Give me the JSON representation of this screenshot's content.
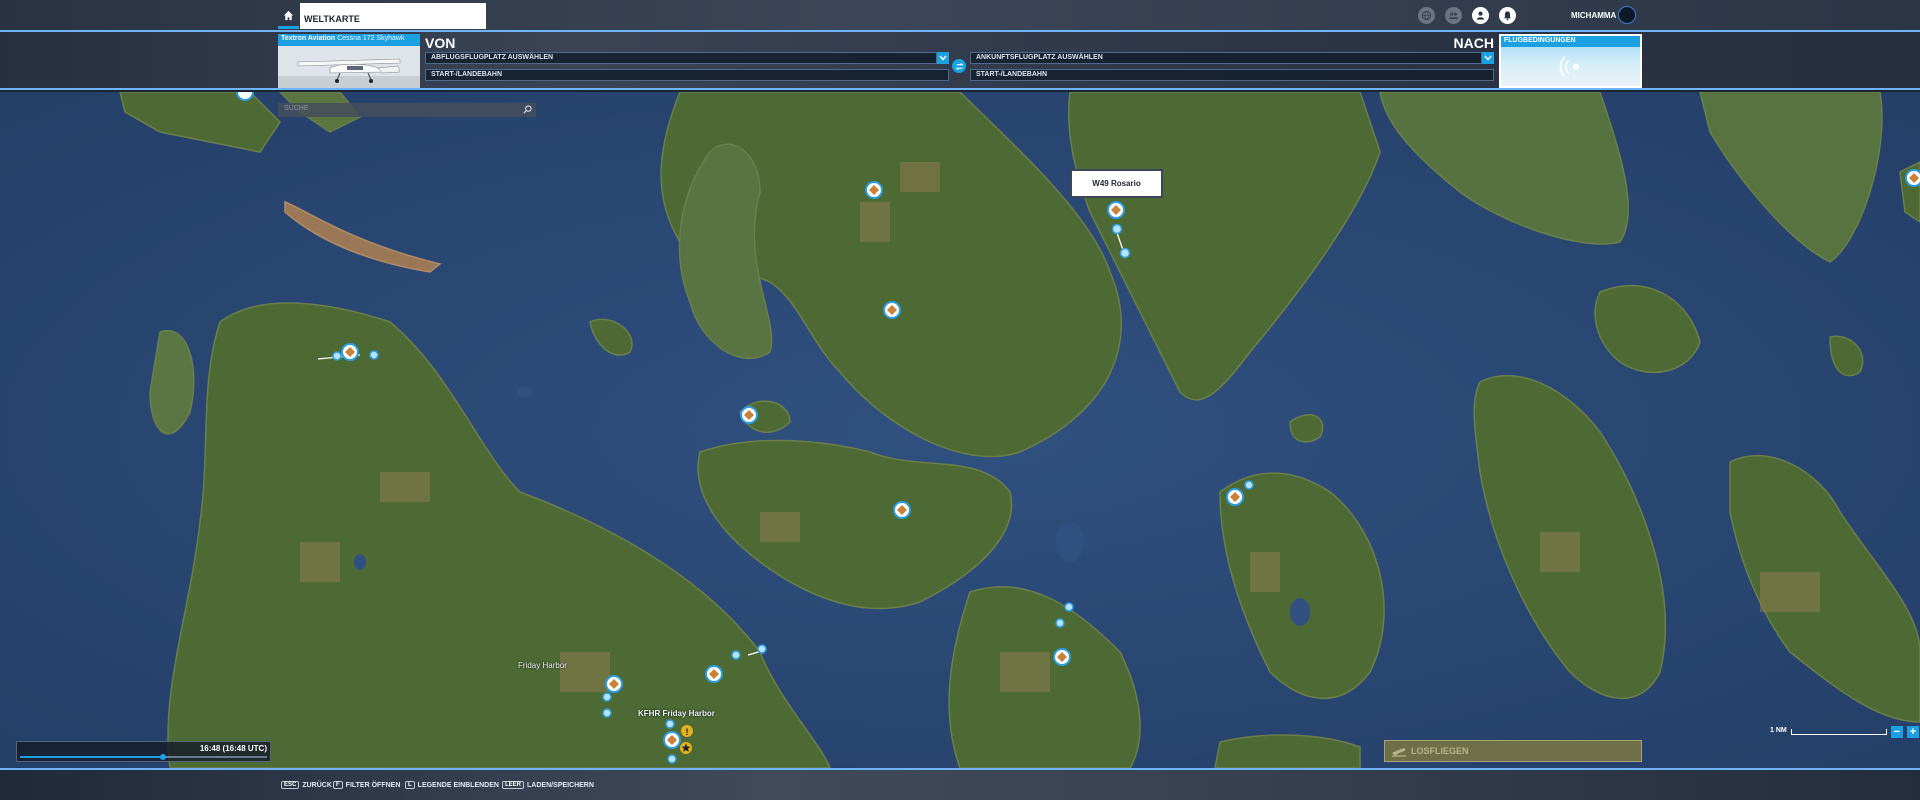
{
  "topbar": {
    "tab_label": "WELTKARTE",
    "username": "MICHAMMA",
    "icons": [
      "globe-icon",
      "community-icon",
      "profile-icon",
      "notification-icon"
    ]
  },
  "flight": {
    "aircraft_maker": "Textron Aviation",
    "aircraft_model": "Cessna 172 Skyhawk",
    "from_label": "VON",
    "to_label": "NACH",
    "departure_placeholder": "ABFLUGSFLUGPLATZ AUSWÄHLEN",
    "departure_runway": "START-/LANDEBAHN",
    "arrival_placeholder": "ANKUNFTSFLUGPLATZ AUSWÄHLEN",
    "arrival_runway": "START-/LANDEBAHN",
    "conditions_label": "FLUGBEDINGUNGEN"
  },
  "map": {
    "search_placeholder": "SUCHE",
    "popup_airport": "W49 Rosario",
    "label_friday_harbor": "Friday Harbor",
    "label_friday_harbor_airport": "KFHR Friday Harbor",
    "scale_label": "1 NM",
    "zoom_out": "−",
    "zoom_in": "+"
  },
  "time": {
    "display": "16:48 (16:48 UTC)",
    "progress": 0.58
  },
  "fly_button_label": "LOSFLIEGEN",
  "bottom_hints": [
    {
      "key": "ESC",
      "label": "ZURÜCK"
    },
    {
      "key": "F",
      "label": "FILTER ÖFFNEN"
    },
    {
      "key": "L",
      "label": "LEGENDE EINBLENDEN"
    },
    {
      "key": "LEER",
      "label": "LADEN/SPEICHERN"
    }
  ],
  "colors": {
    "accent": "#1ba1e2",
    "water": "#2c4a78",
    "land": "#4f6a35",
    "airport_marker": "#c8823a",
    "fly_button": "#787446"
  }
}
